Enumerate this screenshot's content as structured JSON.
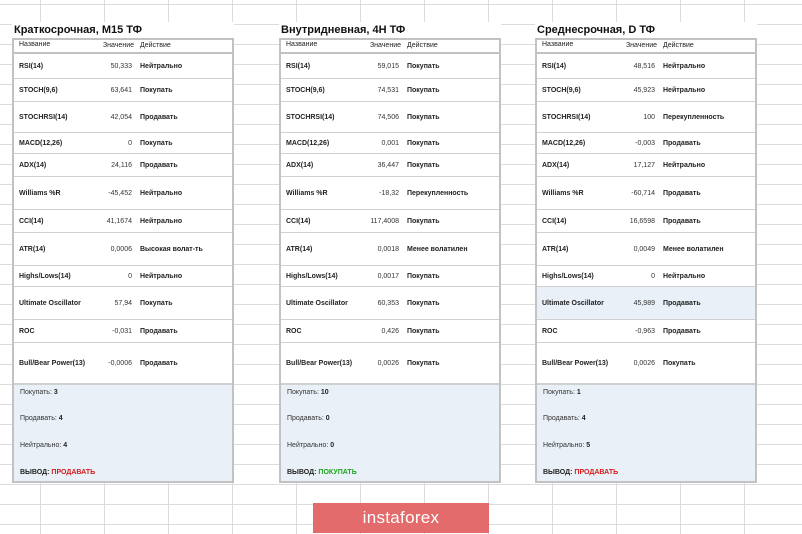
{
  "header": {
    "name": "Название",
    "value": "Значение",
    "action": "Действие"
  },
  "summary_labels": {
    "buy": "Покупать:",
    "sell": "Продавать:",
    "neutral": "Нейтрально:",
    "verdict": "ВЫВОД:"
  },
  "colors": {
    "buy": "#1aa31a",
    "sell": "#d21c1c",
    "summary_bg": "#e9f0f8",
    "logo_bg": "#e36b6b"
  },
  "panels": [
    {
      "title": "Краткосрочная, M15 ТФ",
      "rows": [
        {
          "name": "RSI(14)",
          "value": "50,333",
          "action": "Нейтрально",
          "type": "neutral"
        },
        {
          "name": "STOCH(9,6)",
          "value": "63,641",
          "action": "Покупать",
          "type": "buy"
        },
        {
          "name": "STOCHRSI(14)",
          "value": "42,054",
          "action": "Продавать",
          "type": "sell"
        },
        {
          "name": "MACD(12,26)",
          "value": "0",
          "action": "Покупать",
          "type": "buy"
        },
        {
          "name": "ADX(14)",
          "value": "24,116",
          "action": "Продавать",
          "type": "sell"
        },
        {
          "name": "Williams %R",
          "value": "-45,452",
          "action": "Нейтрально",
          "type": "neutral"
        },
        {
          "name": "CCI(14)",
          "value": "41,1674",
          "action": "Нейтрально",
          "type": "neutral"
        },
        {
          "name": "ATR(14)",
          "value": "0,0006",
          "action": "Высокая волат-ть",
          "type": "neutral"
        },
        {
          "name": "Highs/Lows(14)",
          "value": "0",
          "action": "Нейтрально",
          "type": "neutral"
        },
        {
          "name": "Ultimate Oscillator",
          "value": "57,94",
          "action": "Покупать",
          "type": "buy"
        },
        {
          "name": "ROC",
          "value": "-0,031",
          "action": "Продавать",
          "type": "sell"
        },
        {
          "name": "Bull/Bear Power(13)",
          "value": "-0,0006",
          "action": "Продавать",
          "type": "sell"
        }
      ],
      "summary": {
        "buy": "3",
        "sell": "4",
        "neutral": "4",
        "verdict": "ПРОДАВАТЬ",
        "verdict_type": "sell"
      }
    },
    {
      "title": "Внутридневная, 4H ТФ",
      "rows": [
        {
          "name": "RSI(14)",
          "value": "59,015",
          "action": "Покупать",
          "type": "buy"
        },
        {
          "name": "STOCH(9,6)",
          "value": "74,531",
          "action": "Покупать",
          "type": "buy"
        },
        {
          "name": "STOCHRSI(14)",
          "value": "74,506",
          "action": "Покупать",
          "type": "buy"
        },
        {
          "name": "MACD(12,26)",
          "value": "0,001",
          "action": "Покупать",
          "type": "buy"
        },
        {
          "name": "ADX(14)",
          "value": "36,447",
          "action": "Покупать",
          "type": "buy"
        },
        {
          "name": "Williams %R",
          "value": "-18,32",
          "action": "Перекупленность",
          "type": "neutral"
        },
        {
          "name": "CCI(14)",
          "value": "117,4008",
          "action": "Покупать",
          "type": "buy"
        },
        {
          "name": "ATR(14)",
          "value": "0,0018",
          "action": "Менее волатилен",
          "type": "neutral"
        },
        {
          "name": "Highs/Lows(14)",
          "value": "0,0017",
          "action": "Покупать",
          "type": "buy"
        },
        {
          "name": "Ultimate Oscillator",
          "value": "60,353",
          "action": "Покупать",
          "type": "buy"
        },
        {
          "name": "ROC",
          "value": "0,426",
          "action": "Покупать",
          "type": "buy"
        },
        {
          "name": "Bull/Bear Power(13)",
          "value": "0,0026",
          "action": "Покупать",
          "type": "buy"
        }
      ],
      "summary": {
        "buy": "10",
        "sell": "0",
        "neutral": "0",
        "verdict": "ПОКУПАТЬ",
        "verdict_type": "buy"
      }
    },
    {
      "title": "Среднесрочная, D ТФ",
      "rows": [
        {
          "name": "RSI(14)",
          "value": "48,516",
          "action": "Нейтрально",
          "type": "neutral"
        },
        {
          "name": "STOCH(9,6)",
          "value": "45,923",
          "action": "Нейтрально",
          "type": "neutral"
        },
        {
          "name": "STOCHRSI(14)",
          "value": "100",
          "action": "Перекупленность",
          "type": "neutral"
        },
        {
          "name": "MACD(12,26)",
          "value": "-0,003",
          "action": "Продавать",
          "type": "sell"
        },
        {
          "name": "ADX(14)",
          "value": "17,127",
          "action": "Нейтрально",
          "type": "neutral"
        },
        {
          "name": "Williams %R",
          "value": "-60,714",
          "action": "Продавать",
          "type": "sell"
        },
        {
          "name": "CCI(14)",
          "value": "16,6598",
          "action": "Продавать",
          "type": "sell"
        },
        {
          "name": "ATR(14)",
          "value": "0,0049",
          "action": "Менее волатилен",
          "type": "neutral"
        },
        {
          "name": "Highs/Lows(14)",
          "value": "0",
          "action": "Нейтрально",
          "type": "neutral"
        },
        {
          "name": "Ultimate Oscillator",
          "value": "45,989",
          "action": "Продавать",
          "type": "sell"
        },
        {
          "name": "ROC",
          "value": "-0,963",
          "action": "Продавать",
          "type": "sell"
        },
        {
          "name": "Bull/Bear Power(13)",
          "value": "0,0026",
          "action": "Покупать",
          "type": "buy"
        }
      ],
      "summary": {
        "buy": "1",
        "sell": "4",
        "neutral": "5",
        "verdict": "ПРОДАВАТЬ",
        "verdict_type": "sell"
      }
    }
  ],
  "logo": {
    "text": "instaforex"
  }
}
